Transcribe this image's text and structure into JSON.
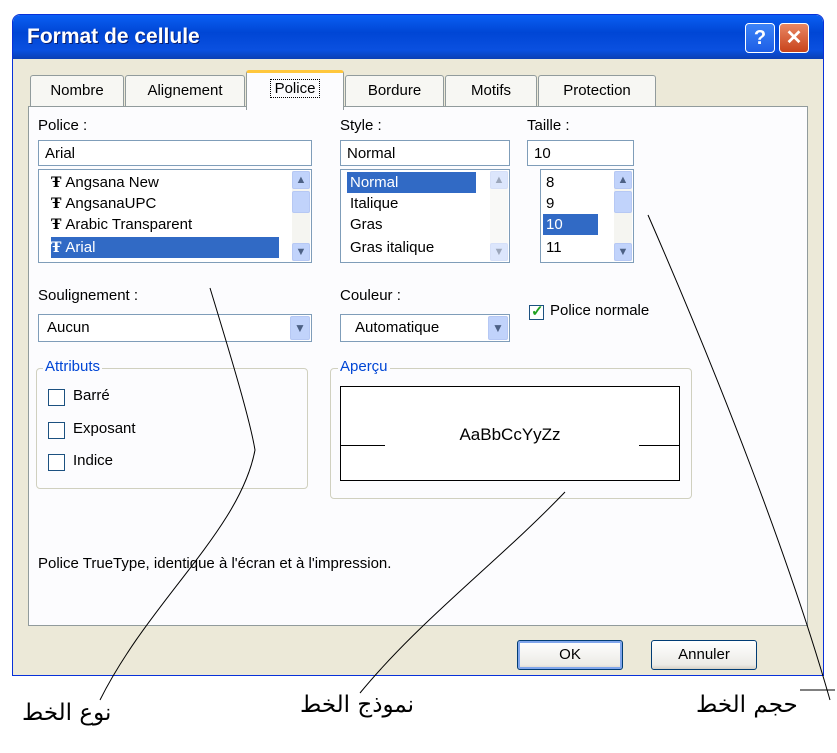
{
  "dialog": {
    "title": "Format de cellule",
    "help_symbol": "?",
    "close_symbol": "✕",
    "tabs": [
      "Nombre",
      "Alignement",
      "Police",
      "Bordure",
      "Motifs",
      "Protection"
    ],
    "active_tab": "Police"
  },
  "police": {
    "label": "Police :",
    "value": "Arial",
    "fonts": [
      "Angsana New",
      "AngsanaUPC",
      "Arabic Transparent",
      "Arial"
    ],
    "selected": "Arial",
    "font_icon_glyph": "Ŧ"
  },
  "style": {
    "label": "Style :",
    "value": "Normal",
    "options": [
      "Normal",
      "Italique",
      "Gras",
      "Gras italique"
    ],
    "selected": "Normal"
  },
  "taille": {
    "label": "Taille :",
    "value": "10",
    "options": [
      "8",
      "9",
      "10",
      "11"
    ],
    "selected": "10"
  },
  "soulignement": {
    "label": "Soulignement :",
    "value": "Aucun"
  },
  "couleur": {
    "label": "Couleur :",
    "value": "Automatique"
  },
  "police_normale": {
    "label": "Police normale",
    "checked": true
  },
  "attributs": {
    "title": "Attributs",
    "items": [
      {
        "label": "Barré",
        "checked": false
      },
      {
        "label": "Exposant",
        "checked": false
      },
      {
        "label": "Indice",
        "checked": false
      }
    ]
  },
  "apercu": {
    "title": "Aperçu",
    "sample": "AaBbCcYyZz"
  },
  "info_text": "Police TrueType, identique à l'écran et à l'impression.",
  "buttons": {
    "ok": "OK",
    "cancel": "Annuler"
  },
  "annotations": {
    "font_type": "نوع الخط",
    "font_sample": "نموذج الخط",
    "font_size": "حجم الخط"
  },
  "colors": {
    "titlebar": "#0054e3",
    "selection": "#316ac5",
    "dialog_bg": "#ece9d8",
    "group_title": "#0046d5"
  }
}
